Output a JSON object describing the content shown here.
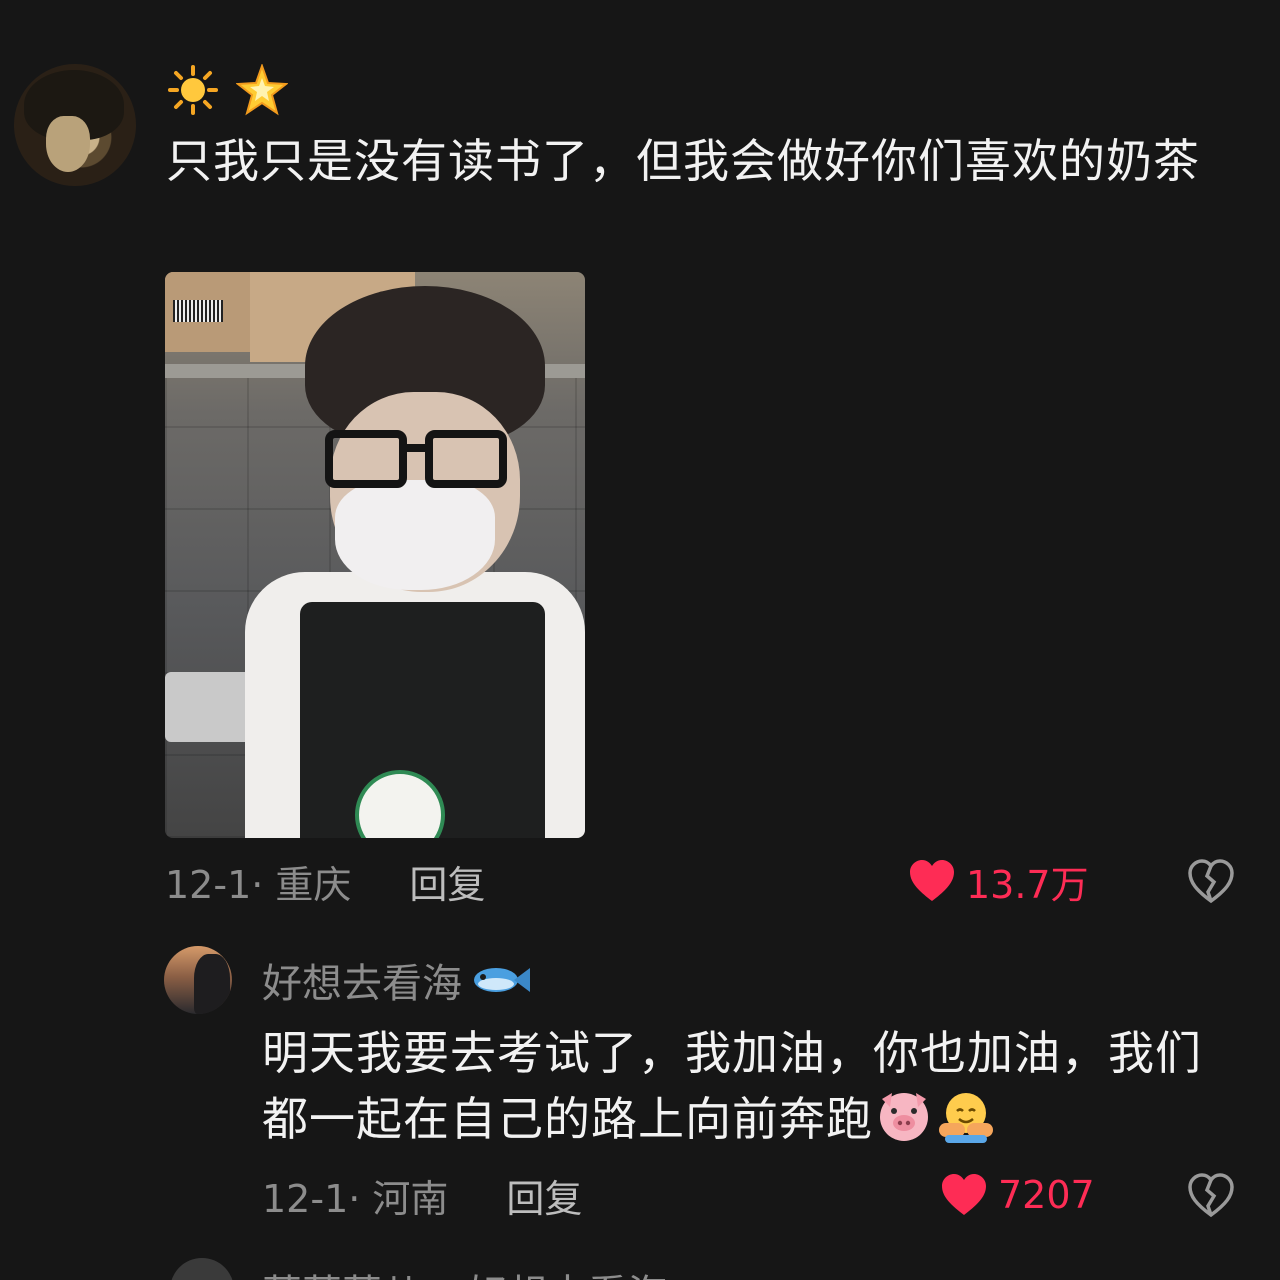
{
  "main_comment": {
    "text": "只我只是没有读书了，但我会做好你们喜欢的奶茶",
    "nickname_icons": [
      "sun-icon",
      "glowing-star-icon"
    ],
    "date_location": "12-1· 重庆",
    "reply_label": "回复",
    "likes": "13.7万"
  },
  "reply_comment": {
    "nickname": "好想去看海",
    "nickname_icon": "fish-icon",
    "text": "明天我要去考试了，我加油，你也加油，我们都一起在自己的路上向前奔跑",
    "emoji": [
      "pig-face-icon",
      "hugging-face-icon"
    ],
    "date_location": "12-1· 河南",
    "reply_label": "回复",
    "likes": "7207"
  },
  "next_reply": {
    "text_partial": "萧萧萧儿 ▸ 好想去看海"
  },
  "colors": {
    "background": "#161616",
    "like": "#fe2c55",
    "secondary_text": "#8c8c8c"
  }
}
